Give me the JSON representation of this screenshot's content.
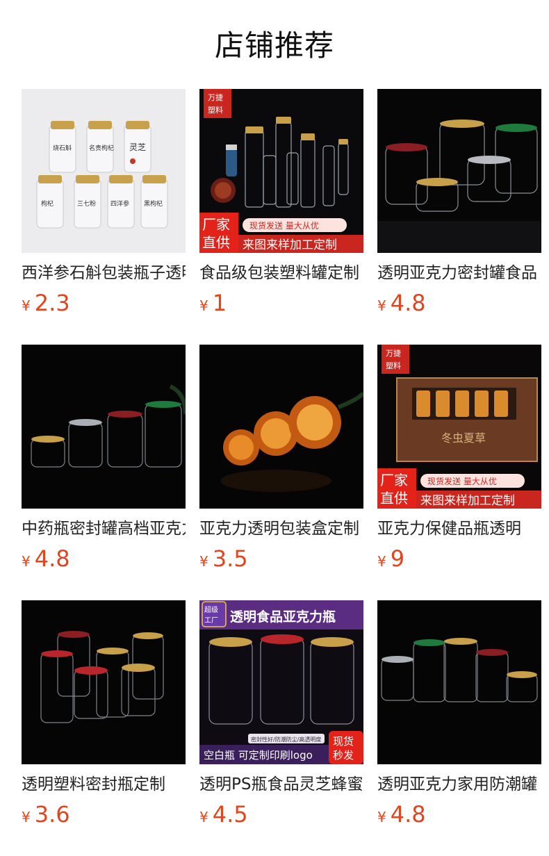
{
  "header": {
    "title": "店铺推荐"
  },
  "products": [
    {
      "title": "西洋参石斛包装瓶子透明",
      "currency": "¥",
      "price": "2.3",
      "image": "labeled-jars-light",
      "labels": [
        "烧石斛",
        "名贵枸杞",
        "灵芝",
        "枸杞",
        "三七粉",
        "四洋参",
        "黑枸杞"
      ]
    },
    {
      "title": "食品级包装塑料罐定制",
      "currency": "¥",
      "price": "1",
      "image": "bottles-promo",
      "brand_top": "万捷",
      "brand_bottom": "塑料",
      "badge_left_top": "厂家",
      "badge_left_bottom": "直供",
      "badge_tag": "现货发送 量大从优",
      "badge_main": "来图来样加工定制"
    },
    {
      "title": "透明亚克力密封罐食品",
      "currency": "¥",
      "price": "4.8",
      "image": "acrylic-jars-dark"
    },
    {
      "title": "中药瓶密封罐高档亚克力",
      "currency": "¥",
      "price": "4.8",
      "image": "jars-row-dark"
    },
    {
      "title": "亚克力透明包装盒定制",
      "currency": "¥",
      "price": "3.5",
      "image": "round-discs-orange"
    },
    {
      "title": "亚克力保健品瓶透明",
      "currency": "¥",
      "price": "9",
      "image": "gift-box-promo",
      "brand_top": "万捷",
      "brand_bottom": "塑料",
      "badge_left_top": "厂家",
      "badge_left_bottom": "直供",
      "badge_tag": "现货发送 量大从优",
      "badge_main": "来图来样加工定制",
      "box_text": "冬虫夏草"
    },
    {
      "title": "透明塑料密封瓶定制",
      "currency": "¥",
      "price": "3.6",
      "image": "colored-lids-dark"
    },
    {
      "title": "透明PS瓶食品灵芝蜂蜜",
      "currency": "¥",
      "price": "4.5",
      "image": "purple-promo",
      "corner_badge_top": "超级",
      "corner_badge_bottom": "工厂",
      "headline": "透明食品亚克力瓶",
      "sub_caption": "密封性好/防潮防尘/高透明度",
      "bar_text": "空白瓶  可定制印刷logo",
      "stock_top": "现货",
      "stock_bottom": "秒发"
    },
    {
      "title": "透明亚克力家用防潮罐",
      "currency": "¥",
      "price": "4.8",
      "image": "jars-row-dark-2"
    }
  ]
}
